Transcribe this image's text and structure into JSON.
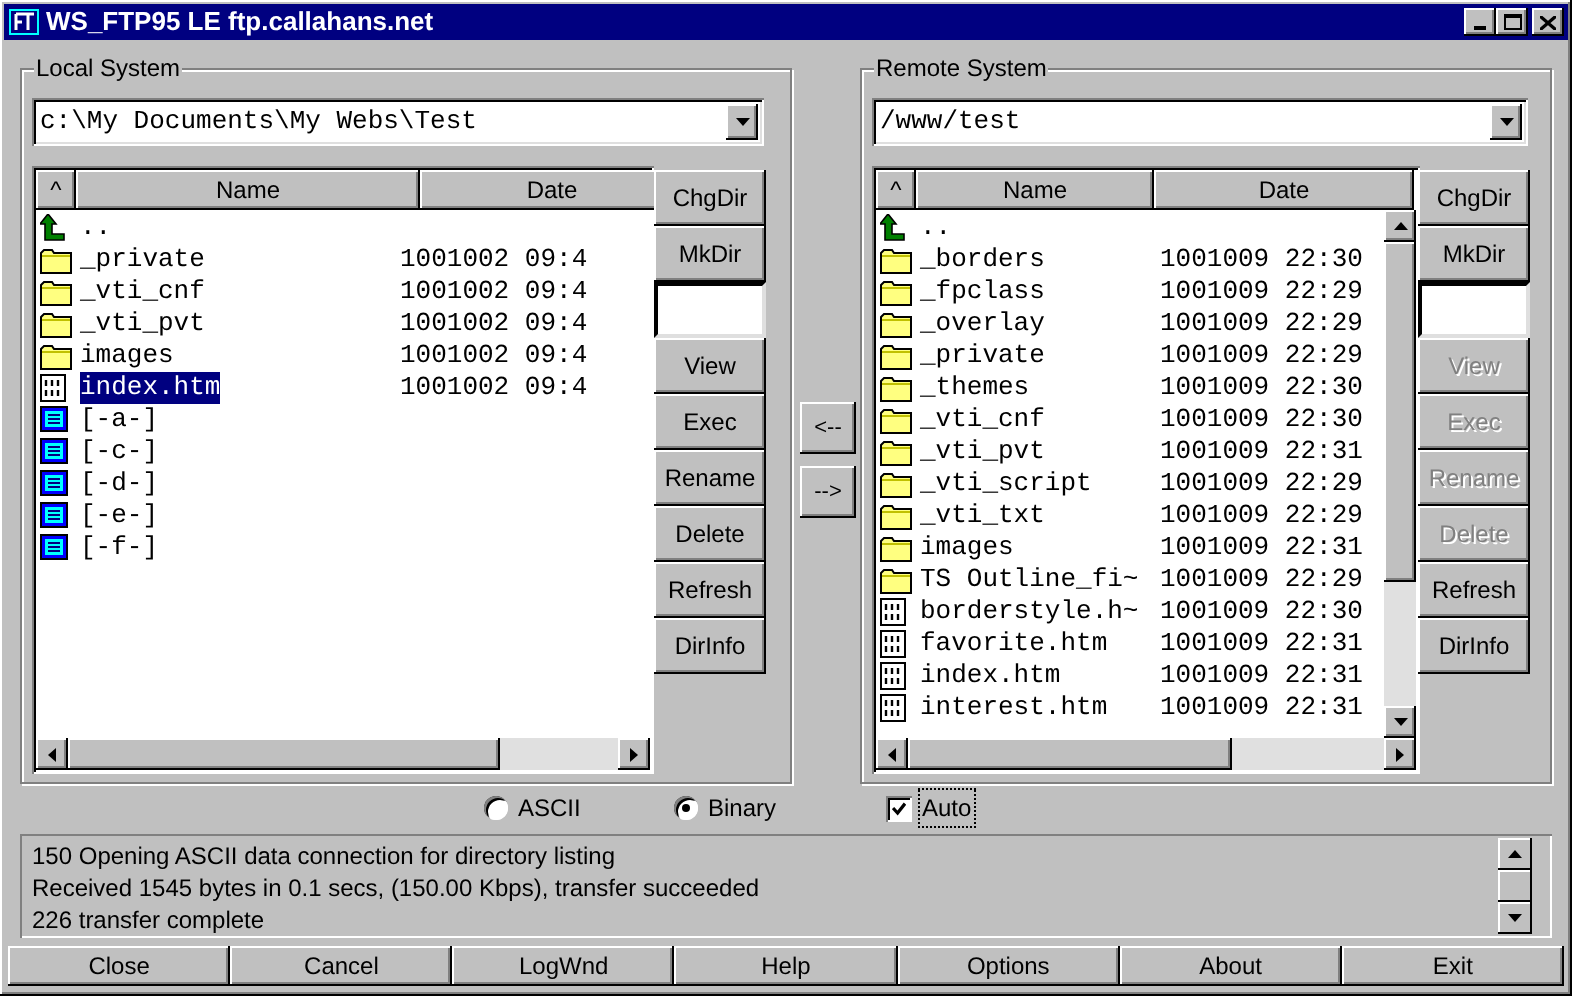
{
  "window": {
    "title": "WS_FTP95 LE ftp.callahans.net"
  },
  "local": {
    "label": "Local System",
    "path": "c:\\My Documents\\My Webs\\Test",
    "columns": [
      "^",
      "Name",
      "Date"
    ],
    "files": [
      {
        "kind": "up",
        "name": "..",
        "selected": false
      },
      {
        "kind": "folder",
        "name": "_private",
        "date": "1001002 09:4",
        "selected": false
      },
      {
        "kind": "folder",
        "name": "_vti_cnf",
        "date": "1001002 09:4",
        "selected": false
      },
      {
        "kind": "folder",
        "name": "_vti_pvt",
        "date": "1001002 09:4",
        "selected": false
      },
      {
        "kind": "folder",
        "name": "images",
        "date": "1001002 09:4",
        "selected": false
      },
      {
        "kind": "file",
        "name": "index.htm",
        "date": "1001002 09:4",
        "selected": true
      },
      {
        "kind": "drive",
        "name": "[-a-]",
        "selected": false
      },
      {
        "kind": "drive",
        "name": "[-c-]",
        "selected": false
      },
      {
        "kind": "drive",
        "name": "[-d-]",
        "selected": false
      },
      {
        "kind": "drive",
        "name": "[-e-]",
        "selected": false
      },
      {
        "kind": "drive",
        "name": "[-f-]",
        "selected": false
      }
    ],
    "buttons": [
      {
        "kind": "button",
        "label": "ChgDir",
        "disabled": false
      },
      {
        "kind": "button",
        "label": "MkDir",
        "disabled": false
      },
      {
        "kind": "field"
      },
      {
        "kind": "button",
        "label": "View",
        "disabled": false
      },
      {
        "kind": "button",
        "label": "Exec",
        "disabled": false
      },
      {
        "kind": "button",
        "label": "Rename",
        "disabled": false
      },
      {
        "kind": "button",
        "label": "Delete",
        "disabled": false
      },
      {
        "kind": "button",
        "label": "Refresh",
        "disabled": false
      },
      {
        "kind": "button",
        "label": "DirInfo",
        "disabled": false
      }
    ]
  },
  "transfer": [
    "<--",
    "-->"
  ],
  "remote": {
    "label": "Remote System",
    "path": "/www/test",
    "columns": [
      "^",
      "Name",
      "Date"
    ],
    "files": [
      {
        "kind": "up",
        "name": "..",
        "selected": false
      },
      {
        "kind": "folder",
        "name": "_borders",
        "date": "1001009 22:30",
        "selected": false
      },
      {
        "kind": "folder",
        "name": "_fpclass",
        "date": "1001009 22:29",
        "selected": false
      },
      {
        "kind": "folder",
        "name": "_overlay",
        "date": "1001009 22:29",
        "selected": false
      },
      {
        "kind": "folder",
        "name": "_private",
        "date": "1001009 22:29",
        "selected": false
      },
      {
        "kind": "folder",
        "name": "_themes",
        "date": "1001009 22:30",
        "selected": false
      },
      {
        "kind": "folder",
        "name": "_vti_cnf",
        "date": "1001009 22:30",
        "selected": false
      },
      {
        "kind": "folder",
        "name": "_vti_pvt",
        "date": "1001009 22:31",
        "selected": false
      },
      {
        "kind": "folder",
        "name": "_vti_script",
        "date": "1001009 22:29",
        "selected": false
      },
      {
        "kind": "folder",
        "name": "_vti_txt",
        "date": "1001009 22:29",
        "selected": false
      },
      {
        "kind": "folder",
        "name": "images",
        "date": "1001009 22:31",
        "selected": false
      },
      {
        "kind": "folder",
        "name": "TS Outline_fi~",
        "date": "1001009 22:29",
        "selected": false
      },
      {
        "kind": "file",
        "name": "borderstyle.h~",
        "date": "1001009 22:30",
        "selected": false
      },
      {
        "kind": "file",
        "name": "favorite.htm",
        "date": "1001009 22:31",
        "selected": false
      },
      {
        "kind": "file",
        "name": "index.htm",
        "date": "1001009 22:31",
        "selected": false
      },
      {
        "kind": "file",
        "name": "interest.htm",
        "date": "1001009 22:31",
        "selected": false
      }
    ],
    "buttons": [
      {
        "kind": "button",
        "label": "ChgDir",
        "disabled": false
      },
      {
        "kind": "button",
        "label": "MkDir",
        "disabled": false
      },
      {
        "kind": "field"
      },
      {
        "kind": "button",
        "label": "View",
        "disabled": true
      },
      {
        "kind": "button",
        "label": "Exec",
        "disabled": true
      },
      {
        "kind": "button",
        "label": "Rename",
        "disabled": true
      },
      {
        "kind": "button",
        "label": "Delete",
        "disabled": true
      },
      {
        "kind": "button",
        "label": "Refresh",
        "disabled": false
      },
      {
        "kind": "button",
        "label": "DirInfo",
        "disabled": false
      }
    ]
  },
  "modes": [
    {
      "label": "ASCII",
      "selected": false
    },
    {
      "label": "Binary",
      "selected": true
    }
  ],
  "auto": {
    "label": "Auto",
    "checked": true
  },
  "log": [
    "150 Opening ASCII data connection for directory listing",
    "Received 1545 bytes in 0.1 secs, (150.00 Kbps), transfer succeeded",
    "226 transfer complete"
  ],
  "bottom_buttons": [
    {
      "label": "Close"
    },
    {
      "label": "Cancel"
    },
    {
      "label": "LogWnd"
    },
    {
      "label": "Help"
    },
    {
      "label": "Options"
    },
    {
      "label": "About"
    },
    {
      "label": "Exit"
    }
  ]
}
